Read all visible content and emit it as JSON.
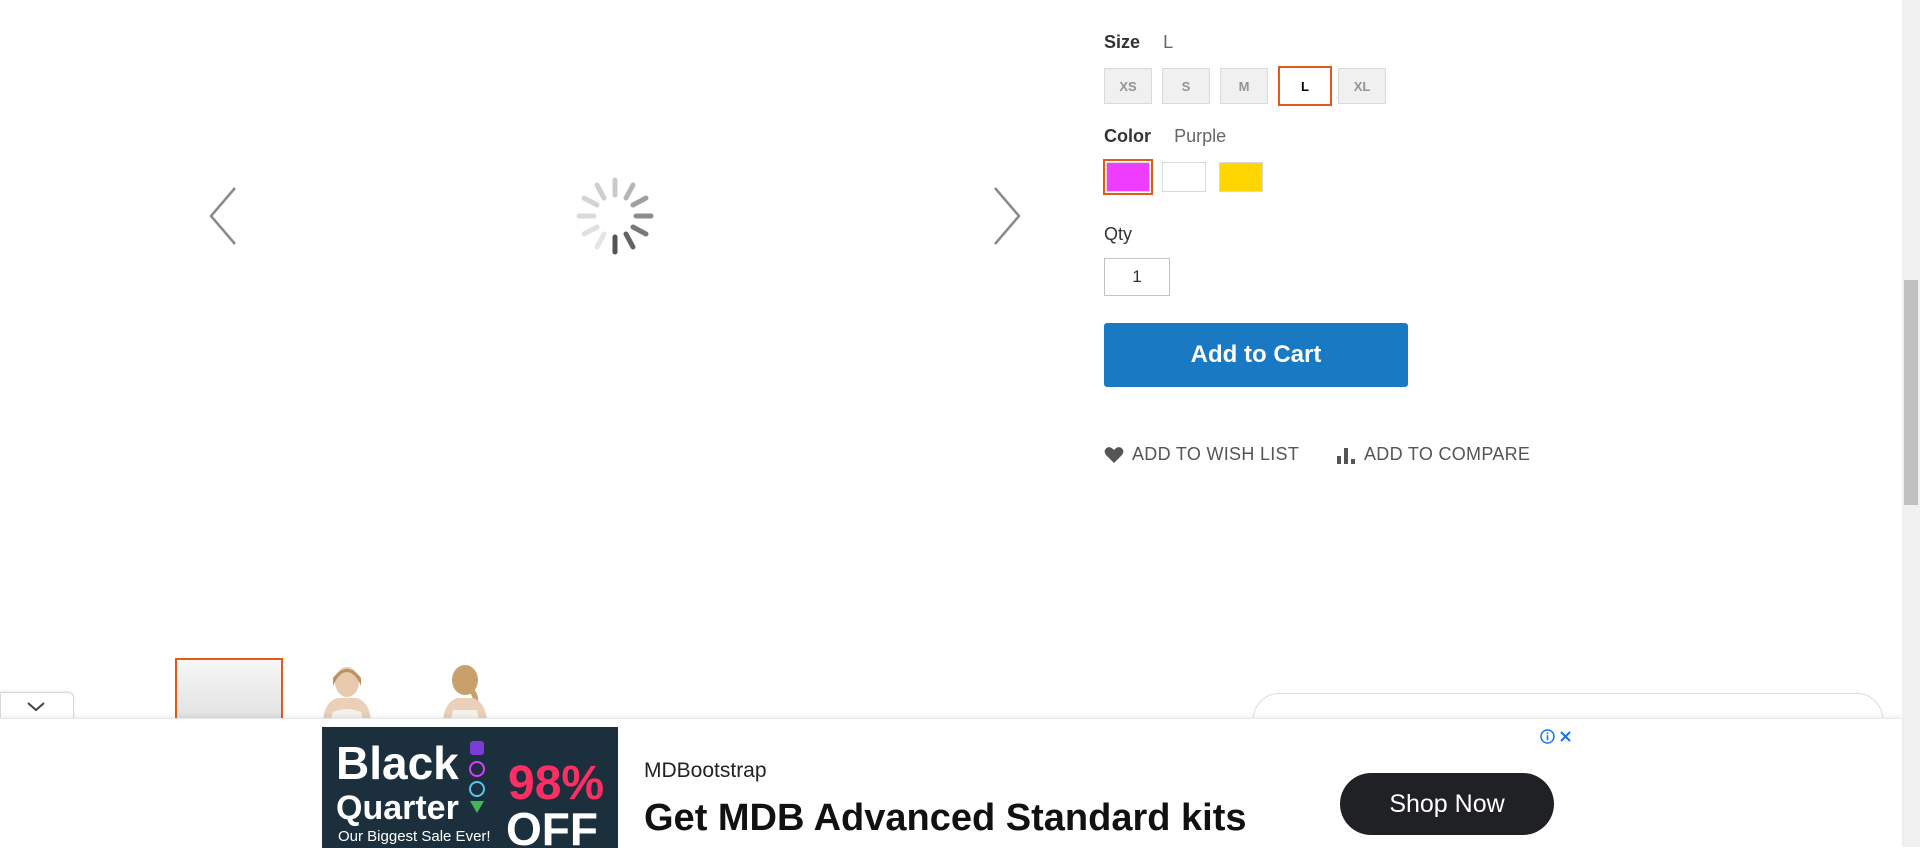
{
  "gallery": {
    "prev_icon": "chevron-left-icon",
    "next_icon": "chevron-right-icon",
    "loading_icon": "loading-spinner-icon",
    "collapse_icon": "chevron-down-icon"
  },
  "options": {
    "size": {
      "label": "Size",
      "selected": "L",
      "choices": [
        "XS",
        "S",
        "M",
        "L",
        "XL"
      ]
    },
    "color": {
      "label": "Color",
      "selected": "Purple",
      "choices": [
        {
          "name": "Purple",
          "hex": "#ef3dff"
        },
        {
          "name": "White",
          "hex": "#ffffff"
        },
        {
          "name": "Yellow",
          "hex": "#ffd500"
        }
      ]
    },
    "qty": {
      "label": "Qty",
      "value": "1"
    }
  },
  "actions": {
    "add_to_cart": "Add to Cart",
    "wish_list": "Add to Wish List",
    "compare": "Add to Compare"
  },
  "colors": {
    "accent": "#1979c3",
    "selected_border": "#e05a1c"
  },
  "ad": {
    "image_line1": "Black",
    "image_line2": "Quarter",
    "image_line3": "Our Biggest Sale Ever!",
    "image_discount": "98%",
    "image_off": "OFF",
    "brand": "MDBootstrap",
    "headline": "Get MDB Advanced Standard kits",
    "cta": "Shop Now",
    "info_icon": "info-icon",
    "close_icon": "close-icon"
  }
}
